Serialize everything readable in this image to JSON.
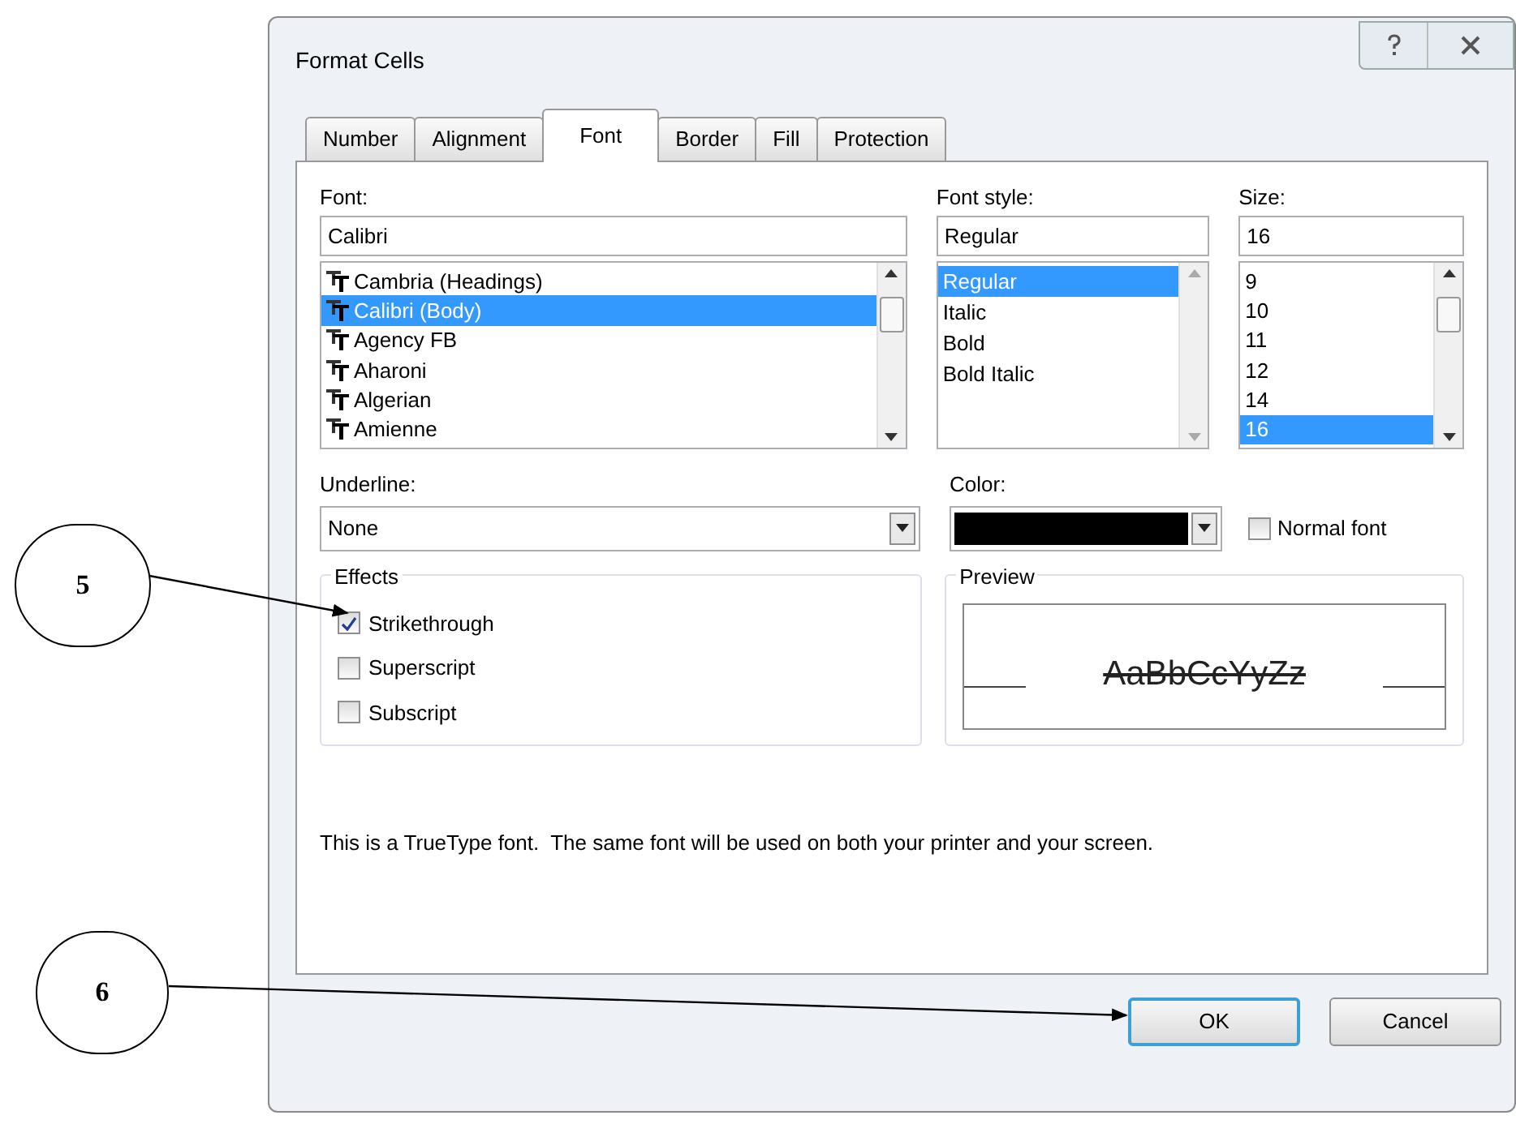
{
  "window": {
    "title": "Format Cells"
  },
  "tabs": [
    {
      "label": "Number",
      "selected": false
    },
    {
      "label": "Alignment",
      "selected": false
    },
    {
      "label": "Font",
      "selected": true
    },
    {
      "label": "Border",
      "selected": false
    },
    {
      "label": "Fill",
      "selected": false
    },
    {
      "label": "Protection",
      "selected": false
    }
  ],
  "font": {
    "label": "Font:",
    "value": "Calibri",
    "items": [
      {
        "label": "Cambria (Headings)",
        "selected": false
      },
      {
        "label": "Calibri (Body)",
        "selected": true
      },
      {
        "label": "Agency FB",
        "selected": false
      },
      {
        "label": "Aharoni",
        "selected": false
      },
      {
        "label": "Algerian",
        "selected": false
      },
      {
        "label": "Amienne",
        "selected": false
      }
    ]
  },
  "font_style": {
    "label": "Font style:",
    "value": "Regular",
    "items": [
      {
        "label": "Regular",
        "selected": true
      },
      {
        "label": "Italic",
        "selected": false
      },
      {
        "label": "Bold",
        "selected": false
      },
      {
        "label": "Bold Italic",
        "selected": false
      }
    ]
  },
  "size": {
    "label": "Size:",
    "value": "16",
    "items": [
      {
        "label": "9",
        "selected": false
      },
      {
        "label": "10",
        "selected": false
      },
      {
        "label": "11",
        "selected": false
      },
      {
        "label": "12",
        "selected": false
      },
      {
        "label": "14",
        "selected": false
      },
      {
        "label": "16",
        "selected": true
      }
    ]
  },
  "underline": {
    "label": "Underline:",
    "value": "None"
  },
  "color": {
    "label": "Color:",
    "color": "#000000"
  },
  "normal_font": {
    "label": "Normal font",
    "checked": false
  },
  "effects": {
    "title": "Effects",
    "items": [
      {
        "label": "Strikethrough",
        "checked": true
      },
      {
        "label": "Superscript",
        "checked": false
      },
      {
        "label": "Subscript",
        "checked": false
      }
    ]
  },
  "preview": {
    "title": "Preview",
    "sample": "AaBbCcYyZz",
    "strikethrough": true
  },
  "info": "This is a TrueType font.  The same font will be used on both your printer and your screen.",
  "buttons": [
    {
      "label": "OK",
      "focused": true
    },
    {
      "label": "Cancel",
      "focused": false
    }
  ],
  "callouts": [
    {
      "label": "5"
    },
    {
      "label": "6"
    }
  ]
}
